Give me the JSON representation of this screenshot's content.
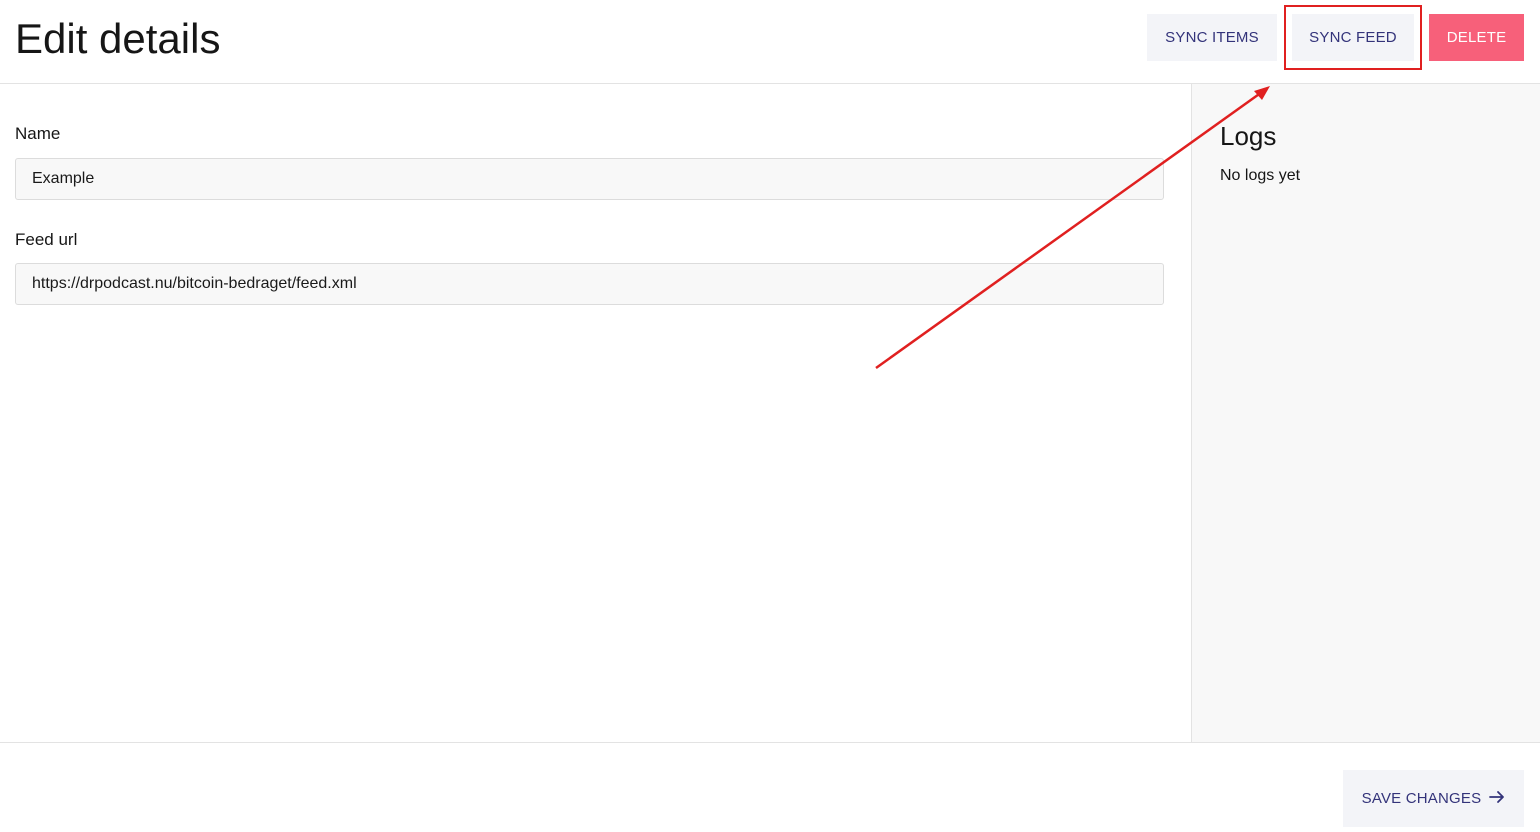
{
  "header": {
    "title": "Edit details",
    "actions": {
      "sync_items": "SYNC ITEMS",
      "sync_feed": "SYNC FEED",
      "delete": "DELETE"
    }
  },
  "form": {
    "name": {
      "label": "Name",
      "value": "Example"
    },
    "feed_url": {
      "label": "Feed url",
      "value": "https://drpodcast.nu/bitcoin-bedraget/feed.xml"
    }
  },
  "logs": {
    "title": "Logs",
    "empty_text": "No logs yet"
  },
  "footer": {
    "save_label": "SAVE CHANGES",
    "save_icon": "arrow-right-icon"
  },
  "colors": {
    "accent_text": "#33337a",
    "danger": "#f7607a",
    "annotation": "#e02020"
  }
}
